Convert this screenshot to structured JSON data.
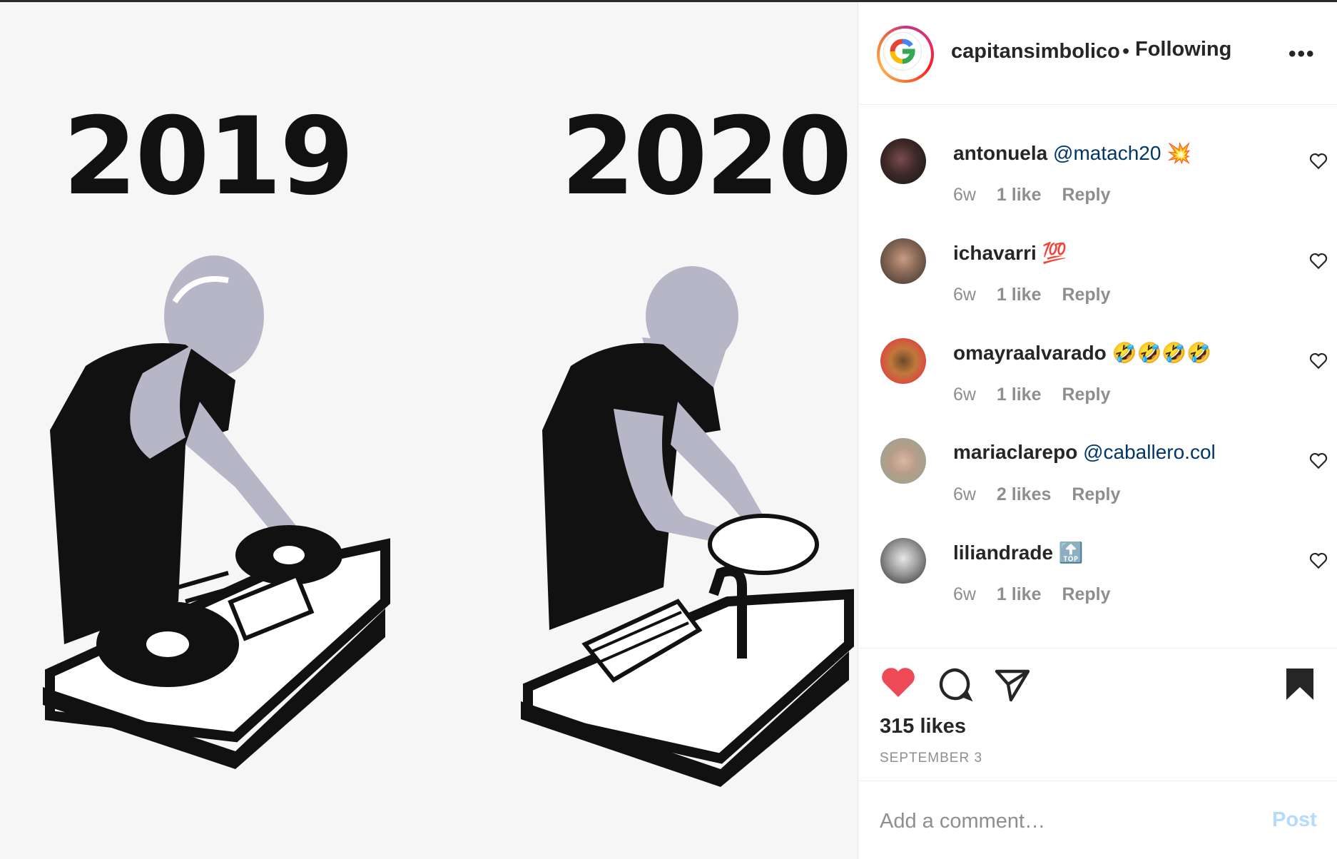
{
  "post": {
    "image_text_left": "2019",
    "image_text_right": "2020",
    "owner": "capitansimbolico",
    "separator": "•",
    "follow_status": "Following",
    "more_label": "•••",
    "likes": "315 likes",
    "date": "SEPTEMBER 3"
  },
  "comments": [
    {
      "user": "antonuela",
      "text": "@matach20",
      "emoji": "💥",
      "time": "6w",
      "likes": "1 like",
      "reply": "Reply"
    },
    {
      "user": "ichavarri",
      "text": "",
      "emoji": "💯",
      "time": "6w",
      "likes": "1 like",
      "reply": "Reply"
    },
    {
      "user": "omayraalvarado",
      "text": "",
      "emoji": "🤣🤣🤣🤣",
      "time": "6w",
      "likes": "1 like",
      "reply": "Reply"
    },
    {
      "user": "mariaclarepo",
      "text": "@caballero.col",
      "emoji": "",
      "time": "6w",
      "likes": "2 likes",
      "reply": "Reply"
    },
    {
      "user": "liliandrade",
      "text": "",
      "emoji": "🔝",
      "time": "6w",
      "likes": "1 like",
      "reply": "Reply"
    }
  ],
  "add_comment": {
    "placeholder": "Add a comment…",
    "post_label": "Post"
  },
  "colors": {
    "like_red": "#ed4956",
    "link_blue": "#00376b",
    "post_disabled": "#b3dbff",
    "muted": "#8e8e8e"
  }
}
